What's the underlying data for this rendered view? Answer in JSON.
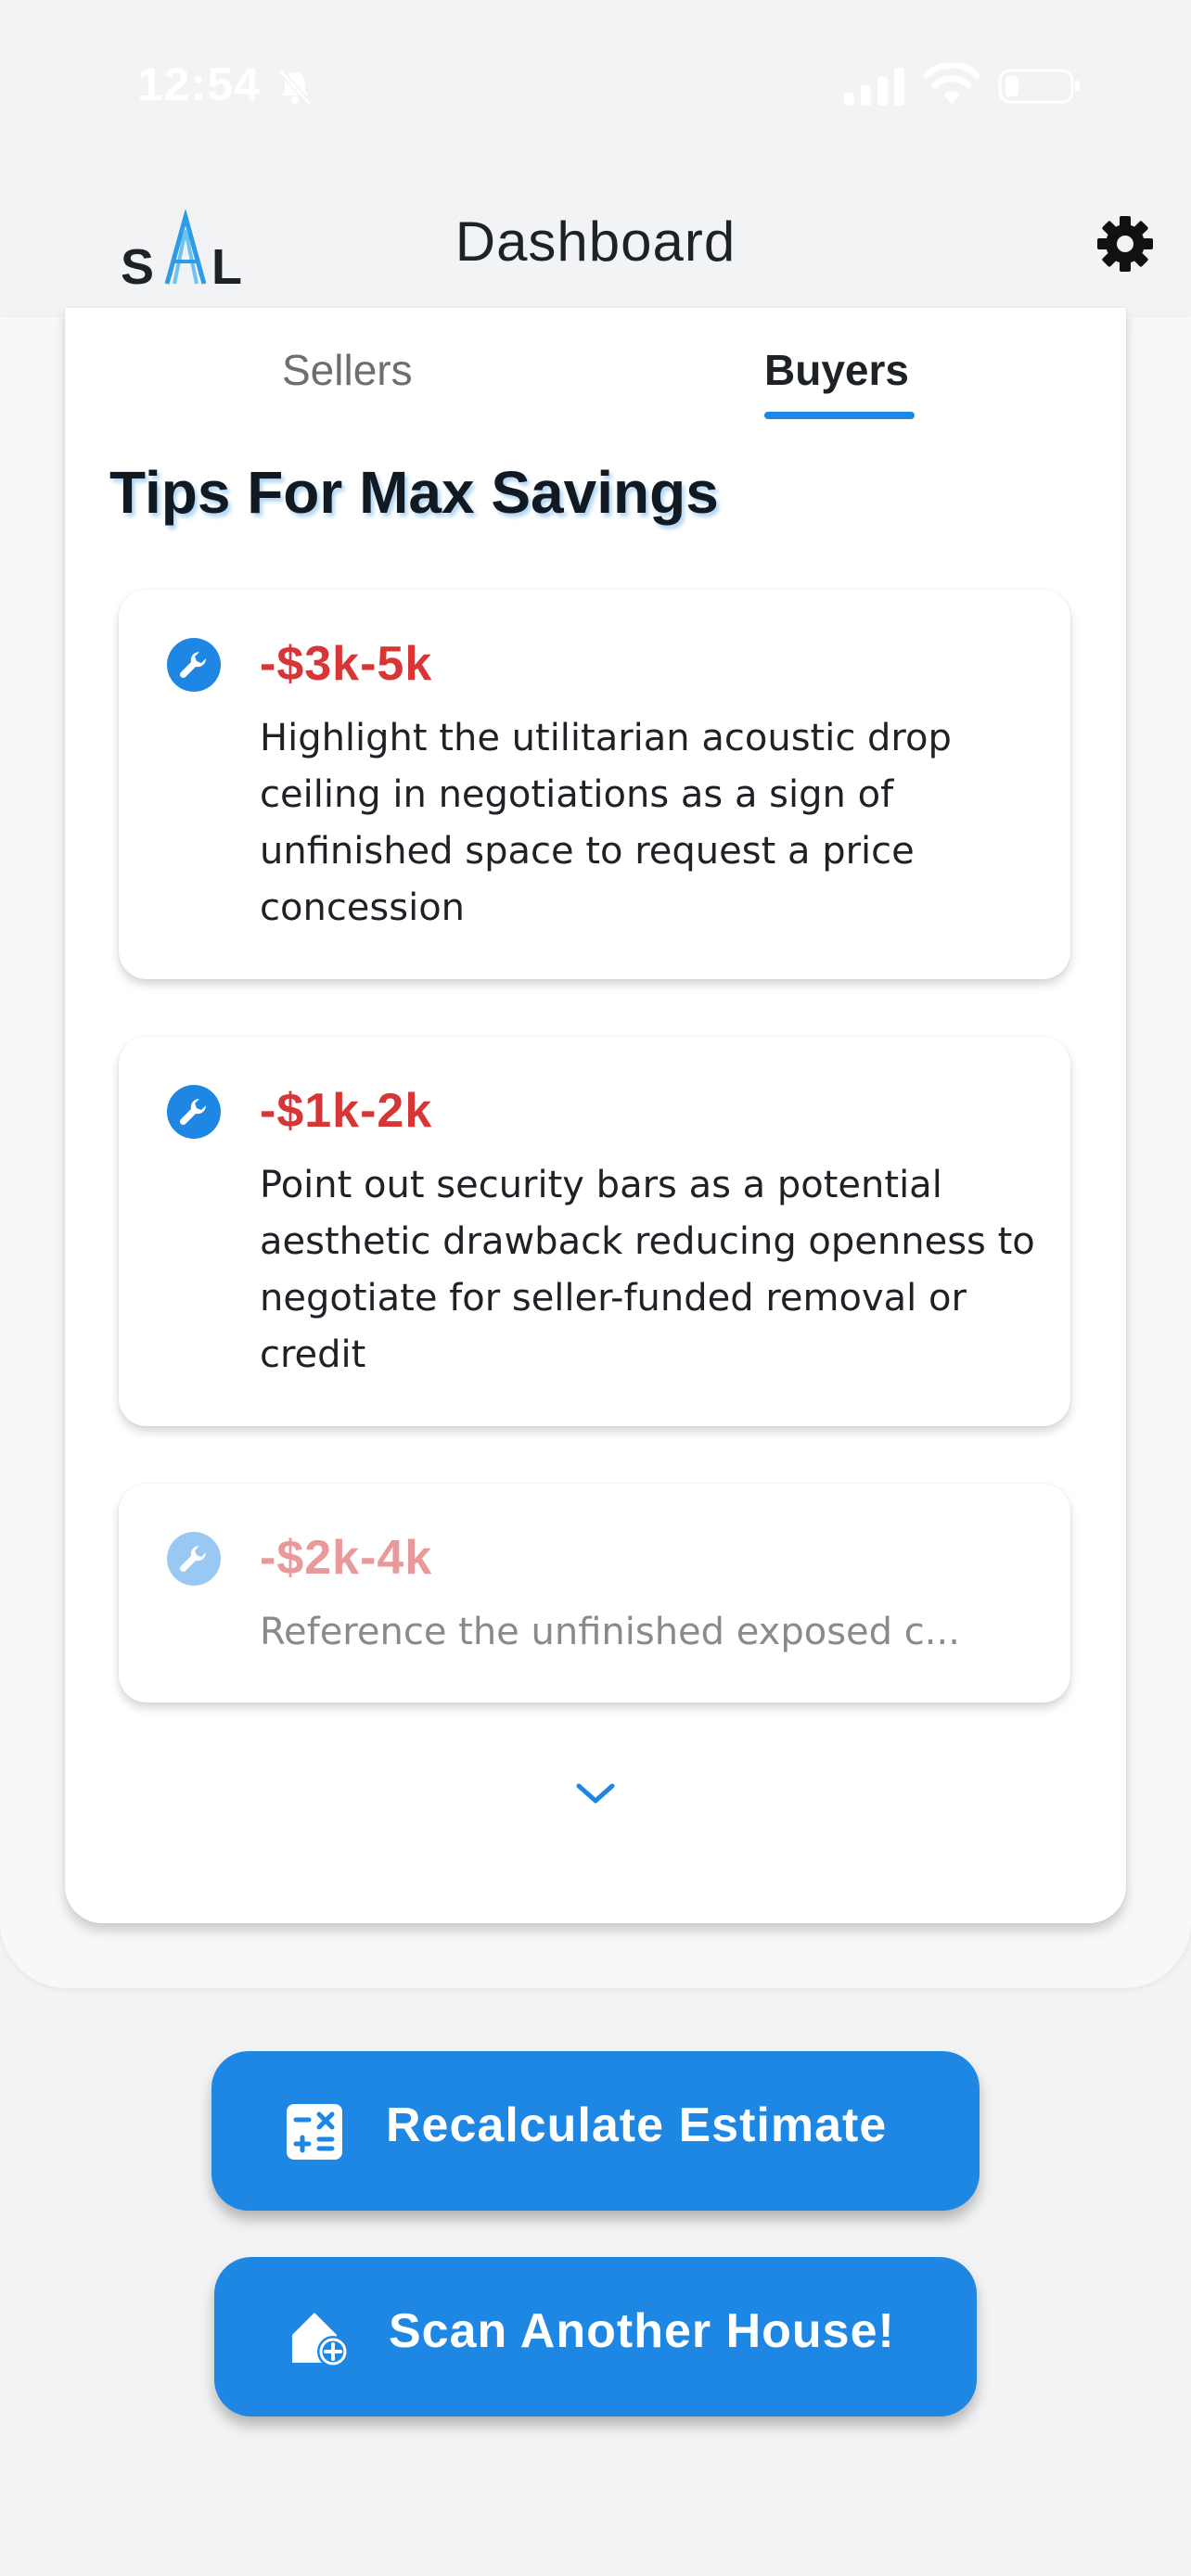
{
  "status_bar": {
    "time": "12:54",
    "icons": [
      "bell-slash-icon",
      "signal-icon",
      "wifi-icon",
      "battery-icon"
    ]
  },
  "nav": {
    "logo_text": "SAL",
    "title": "Dashboard",
    "settings_icon": "gear-icon"
  },
  "tabs": [
    {
      "label": "Sellers",
      "selected": false
    },
    {
      "label": "Buyers",
      "selected": true
    }
  ],
  "section": {
    "title": "Tips For Max Savings"
  },
  "tips": [
    {
      "amount": "-$3k-5k",
      "text": "Highlight the utilitarian acoustic drop ceiling in negotiations as a sign of unfinished space to request a price concession",
      "icon": "wrench-icon"
    },
    {
      "amount": "-$1k-2k",
      "text": "Point out security bars as a potential aesthetic drawback reducing openness to negotiate for seller-funded removal or credit",
      "icon": "wrench-icon"
    },
    {
      "amount": "-$2k-4k",
      "text": "Reference the unfinished exposed c...",
      "icon": "wrench-icon",
      "faded": true
    }
  ],
  "expand_icon": "chevron-down-icon",
  "buttons": {
    "recalculate": {
      "label": "Recalculate Estimate",
      "icon": "calculator-icon"
    },
    "scan": {
      "label": "Scan Another House!",
      "icon": "house-add-icon"
    }
  },
  "colors": {
    "accent": "#1e86e3",
    "savings_red": "#d63636",
    "background": "#f2f3f5"
  }
}
